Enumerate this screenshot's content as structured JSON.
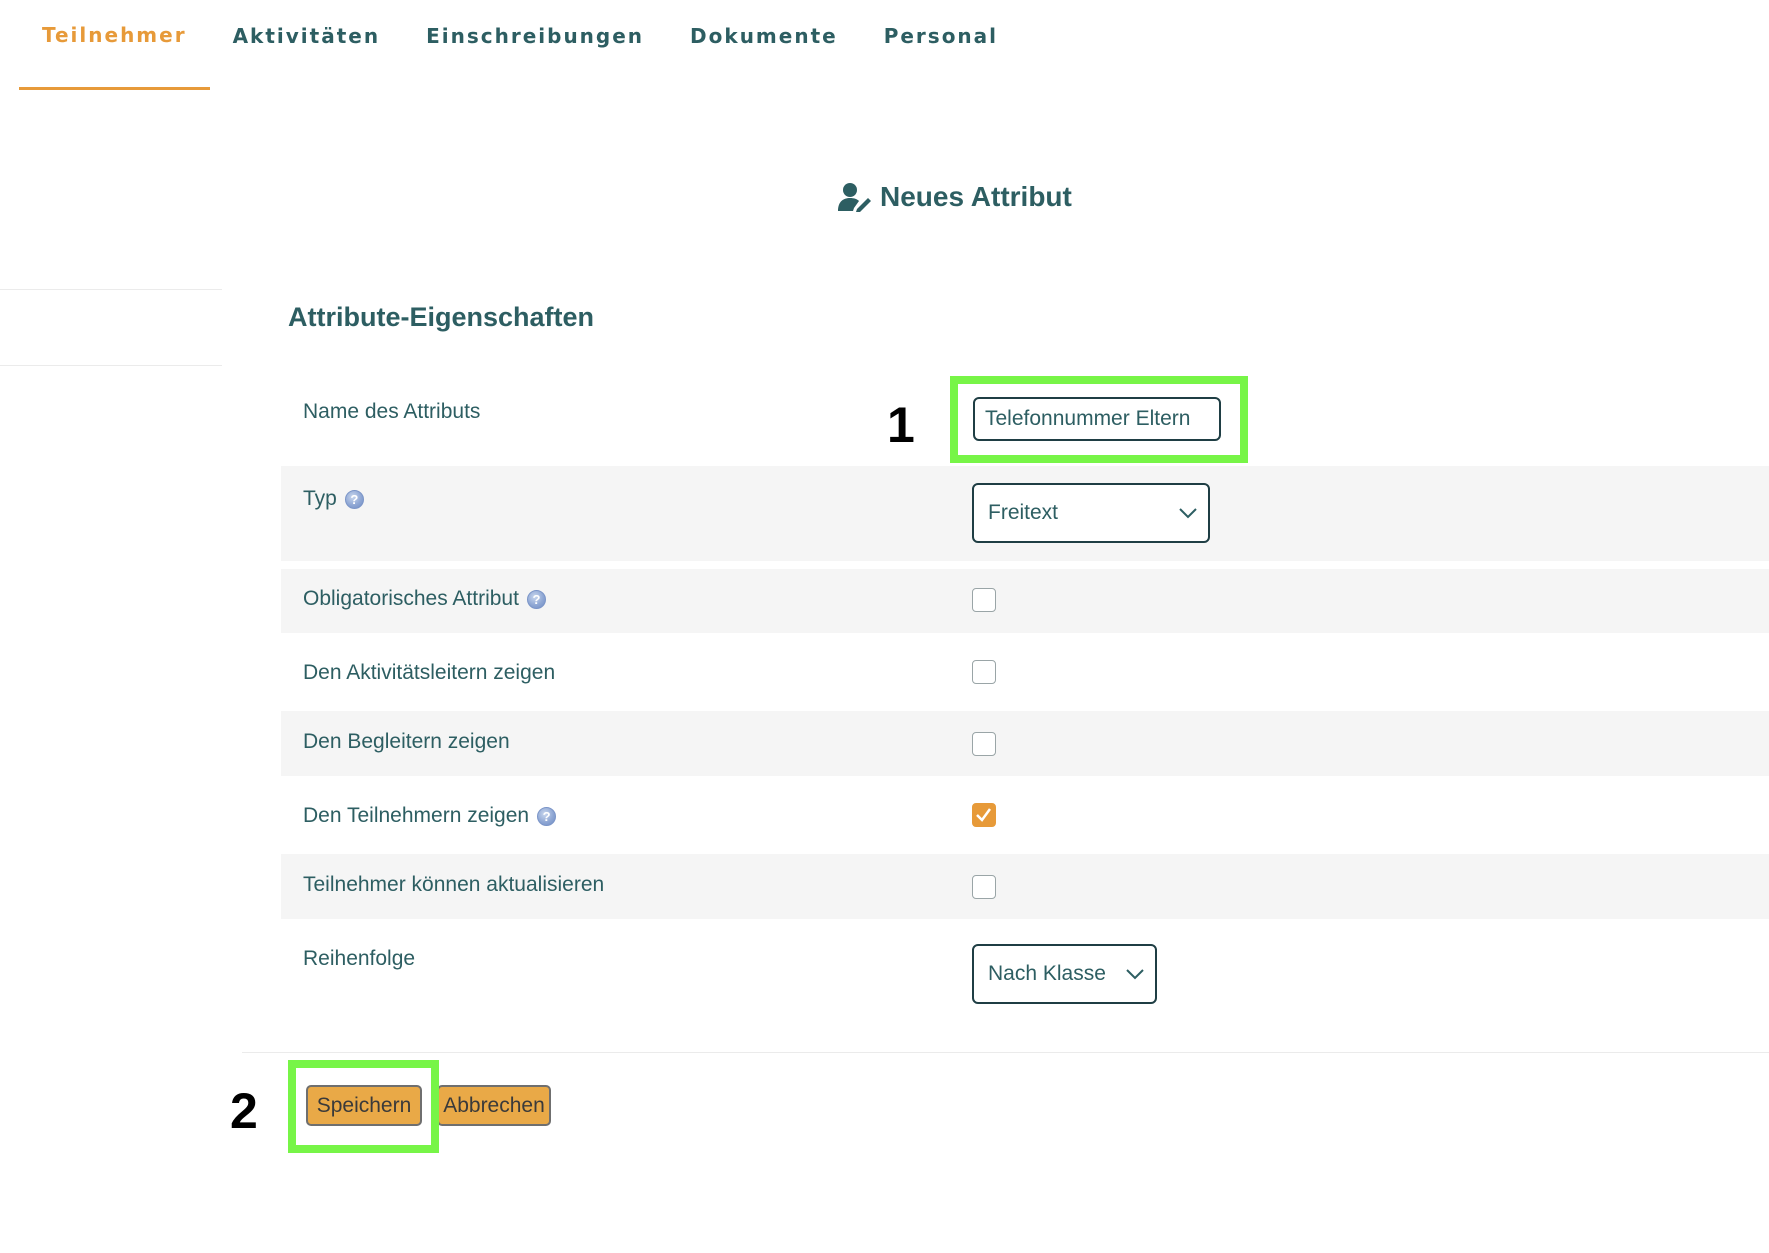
{
  "tabs": [
    {
      "label": "Teilnehmer",
      "active": true
    },
    {
      "label": "Aktivitäten",
      "active": false
    },
    {
      "label": "Einschreibungen",
      "active": false
    },
    {
      "label": "Dokumente",
      "active": false
    },
    {
      "label": "Personal",
      "active": false
    }
  ],
  "page": {
    "title": "Neues Attribut",
    "title_icon": "user-edit-icon",
    "section_heading": "Attribute-Eigenschaften"
  },
  "form": {
    "name_label": "Name des Attributs",
    "name_value": "Telefonnummer Eltern",
    "type_label": "Typ",
    "type_value": "Freitext",
    "mandatory_label": "Obligatorisches Attribut",
    "mandatory_checked": false,
    "show_leaders_label": "Den Aktivitätsleitern zeigen",
    "show_leaders_checked": false,
    "show_companions_label": "Den Begleitern zeigen",
    "show_companions_checked": false,
    "show_participants_label": "Den Teilnehmern zeigen",
    "show_participants_checked": true,
    "participants_update_label": "Teilnehmer können aktualisieren",
    "participants_update_checked": false,
    "order_label": "Reihenfolge",
    "order_value": "Nach Klasse"
  },
  "actions": {
    "save_label": "Speichern",
    "cancel_label": "Abbrechen"
  },
  "annotations": {
    "callout_1": "1",
    "callout_2": "2",
    "highlight_color": "#77f547"
  },
  "colors": {
    "accent": "#e79a39",
    "text": "#2d5e62",
    "button": "#e9a947"
  }
}
